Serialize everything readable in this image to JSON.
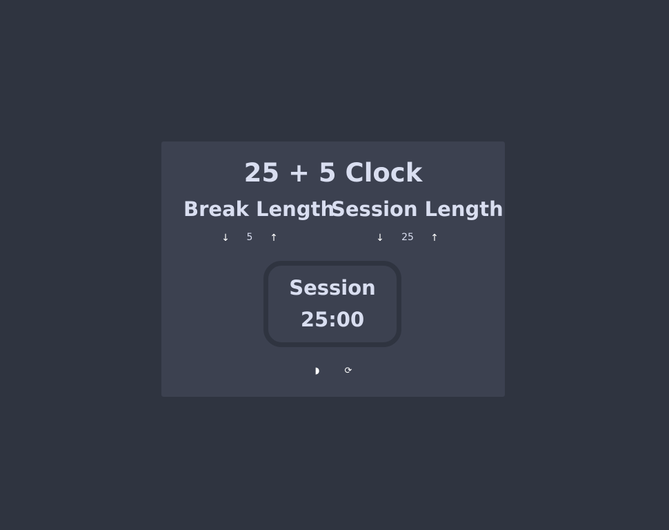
{
  "app": {
    "title": "25 + 5 Clock"
  },
  "break": {
    "label": "Break Length",
    "value": "5",
    "decrement_icon": "↓",
    "increment_icon": "↑"
  },
  "session": {
    "label": "Session Length",
    "value": "25",
    "decrement_icon": "↓",
    "increment_icon": "↑"
  },
  "timer": {
    "label": "Session",
    "time_left": "25:00"
  },
  "controls": {
    "play_pause_icon": "◗",
    "reset_icon": "⟳"
  },
  "colors": {
    "background": "#2f3440",
    "panel": "#3c4150",
    "text": "#d9def0"
  }
}
